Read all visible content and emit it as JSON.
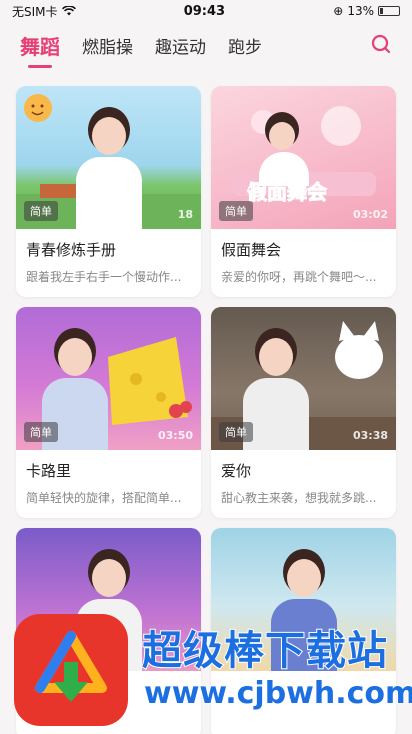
{
  "status": {
    "carrier": "无SIM卡",
    "time": "09:43",
    "battery": "13%"
  },
  "tabs": [
    {
      "label": "舞蹈",
      "active": true
    },
    {
      "label": "燃脂操",
      "active": false
    },
    {
      "label": "趣运动",
      "active": false
    },
    {
      "label": "跑步",
      "active": false
    }
  ],
  "cards": [
    {
      "title": "青春修炼手册",
      "desc": "跟着我左手右手一个慢动作...",
      "badge": "简单",
      "duration": "18"
    },
    {
      "title": "假面舞会",
      "desc": "亲爱的你呀，再跳个舞吧～...",
      "badge": "简单",
      "duration": "03:02",
      "art_text": "假面舞会"
    },
    {
      "title": "卡路里",
      "desc": "简单轻快的旋律，搭配简单...",
      "badge": "简单",
      "duration": "03:50"
    },
    {
      "title": "爱你",
      "desc": "甜心教主来袭，想我就多跳...",
      "badge": "简单",
      "duration": "03:38"
    },
    {
      "title": "",
      "desc": "",
      "badge": "",
      "duration": ""
    },
    {
      "title": "",
      "desc": "",
      "badge": "",
      "duration": ""
    }
  ],
  "watermark": {
    "title": "超级棒下载站",
    "url": "www.cjbwh.com"
  },
  "colors": {
    "accent": "#e63f74",
    "watermark_blue": "#1c6fe0"
  }
}
